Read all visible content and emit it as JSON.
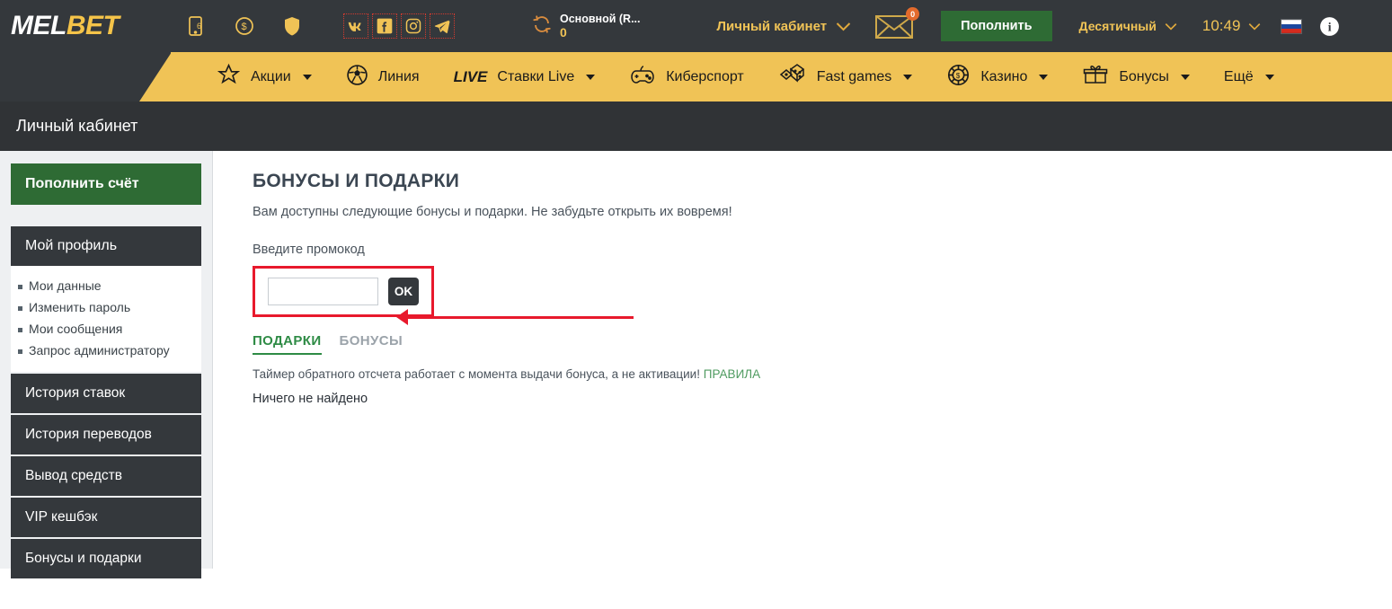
{
  "brand": {
    "part1": "MEL",
    "part2": "BET"
  },
  "header": {
    "icons": [
      {
        "name": "mobile-app-icon"
      },
      {
        "name": "dollar-coin-icon"
      },
      {
        "name": "shield-icon"
      }
    ],
    "social": [
      {
        "name": "vk-icon",
        "label": "VK"
      },
      {
        "name": "facebook-icon",
        "label": "f"
      },
      {
        "name": "instagram-icon",
        "label": "Instagram"
      },
      {
        "name": "telegram-icon",
        "label": "Telegram"
      }
    ],
    "balance": {
      "label": "Основной (R...",
      "amount": "0"
    },
    "cabinet": "Личный кабинет",
    "mail_badge": "0",
    "deposit": "Пополнить",
    "odds_format": "Десятичный",
    "time": "10:49",
    "language": "ru"
  },
  "nav": [
    {
      "icon": "star-icon",
      "label": "Акции",
      "caret": true
    },
    {
      "icon": "football-icon",
      "label": "Линия",
      "caret": false
    },
    {
      "icon": "live-tag",
      "tag": "LIVE",
      "label": "Ставки Live",
      "caret": true
    },
    {
      "icon": "gamepad-icon",
      "label": "Киберспорт",
      "caret": false
    },
    {
      "icon": "dice-icon",
      "label": "Fast games",
      "caret": true
    },
    {
      "icon": "casino-chip-icon",
      "label": "Казино",
      "caret": true
    },
    {
      "icon": "gift-icon",
      "label": "Бонусы",
      "caret": true
    },
    {
      "icon": "",
      "label": "Ещё",
      "caret": true
    }
  ],
  "breadcrumb": {
    "title": "Личный кабинет"
  },
  "sidebar": {
    "deposit_button": "Пополнить счёт",
    "profile_header": "Мой профиль",
    "profile_items": [
      "Мои данные",
      "Изменить пароль",
      "Мои сообщения",
      "Запрос администратору"
    ],
    "items": [
      "История ставок",
      "История переводов",
      "Вывод средств",
      "VIP кешбэк",
      "Бонусы и подарки"
    ]
  },
  "main": {
    "title": "БОНУСЫ И ПОДАРКИ",
    "subtitle": "Вам доступны следующие бонусы и подарки. Не забудьте открыть их вовремя!",
    "promo_label": "Введите промокод",
    "promo_value": "",
    "promo_placeholder": "",
    "ok_button": "OK",
    "tabs": [
      {
        "label": "ПОДАРКИ",
        "active": true
      },
      {
        "label": "БОНУСЫ",
        "active": false
      }
    ],
    "note_text": "Таймер обратного отсчета работает с момента выдачи бонуса, а не активации!",
    "note_rules": "ПРАВИЛА",
    "empty_message": "Ничего не найдено"
  },
  "colors": {
    "brand_yellow": "#f0c356",
    "dark": "#34383c",
    "green": "#2e6b34",
    "accent_red": "#e8192c",
    "tab_green": "#2e8b45"
  }
}
